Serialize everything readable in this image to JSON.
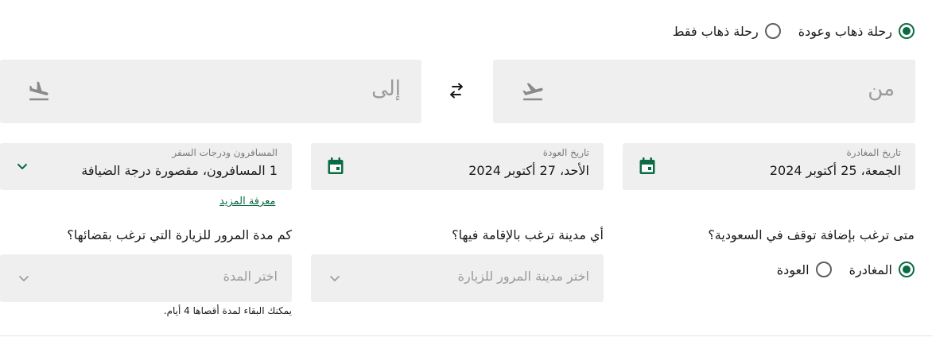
{
  "trip_type": {
    "options": [
      {
        "label": "رحلة ذهاب وعودة",
        "selected": true
      },
      {
        "label": "رحلة ذهاب فقط",
        "selected": false
      }
    ]
  },
  "route": {
    "from_placeholder": "من",
    "to_placeholder": "إلى",
    "from_icon": "plane-takeoff-icon",
    "to_icon": "plane-landing-icon",
    "swap_icon": "swap-arrows-icon"
  },
  "dates": {
    "departure_label": "تاريخ المغادرة",
    "departure_value": "الجمعة، 25 أكتوبر 2024",
    "return_label": "تاريخ العودة",
    "return_value": "الأحد، 27 أكتوبر 2024",
    "calendar_icon": "calendar-icon"
  },
  "passengers": {
    "label": "المسافرون ودرجات السفر",
    "value": "1 المسافرون، مقصورة درجة الضيافة",
    "more_link": "معرفة المزيد"
  },
  "stopover": {
    "question_when": "متى ترغب بإضافة توقف في السعودية؟",
    "when_options": [
      {
        "label": "المغادرة",
        "selected": true
      },
      {
        "label": "العودة",
        "selected": false
      }
    ],
    "question_city": "أي مدينة ترغب بالإقامة فيها؟",
    "city_placeholder": "اختر مدينة المرور للزيارة",
    "question_duration": "كم مدة المرور للزيارة التي ترغب بقضائها؟",
    "duration_placeholder": "اختر المدة",
    "duration_hint": "يمكنك البقاء لمدة أقصاها 4 أيام."
  },
  "colors": {
    "accent": "#0b6b45",
    "field_bg": "#efefef",
    "placeholder": "#9a9a9a",
    "icon_gray": "#8a8a8a"
  }
}
